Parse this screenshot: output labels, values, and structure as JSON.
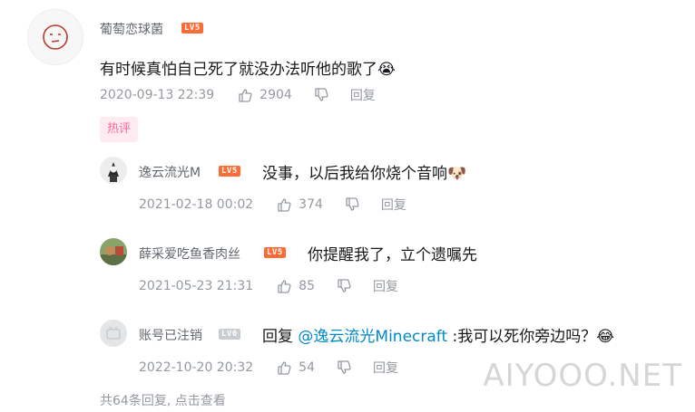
{
  "comment": {
    "username": "葡萄恋球菌",
    "level": "LV5",
    "text": "有时候真怕自己死了就没办法听他的歌了",
    "emoji": "😭",
    "date": "2020-09-13 22:39",
    "likes": "2904",
    "reply_label": "回复",
    "hot_label": "热评"
  },
  "replies": [
    {
      "username": "逸云流光M",
      "level": "LV5",
      "text": "没事，以后我给你烧个音响",
      "emoji": "🐶",
      "date": "2021-02-18 00:02",
      "likes": "374",
      "reply_label": "回复"
    },
    {
      "username": "薛采爱吃鱼香肉丝",
      "level": "LV5",
      "text": "你提醒我了，立个遗嘱先",
      "date": "2021-05-23 21:31",
      "likes": "85",
      "reply_label": "回复"
    },
    {
      "username": "账号已注销",
      "level": "LV0",
      "prefix": "回复 ",
      "mention": "@逸云流光Minecraft",
      "text": " :我可以死你旁边吗？",
      "emoji": "😂",
      "date": "2022-10-20 20:32",
      "likes": "54",
      "reply_label": "回复"
    }
  ],
  "more_text": "共64条回复, 点击查看",
  "watermark": "AIYOOO.NET",
  "colors": {
    "hot_text": "#ff6699",
    "hot_bg": "#ffecf1",
    "mention": "#008ac5",
    "level_orange": "#ff6b36",
    "level_gray": "#c9ccd0",
    "meta": "#9499a0"
  }
}
